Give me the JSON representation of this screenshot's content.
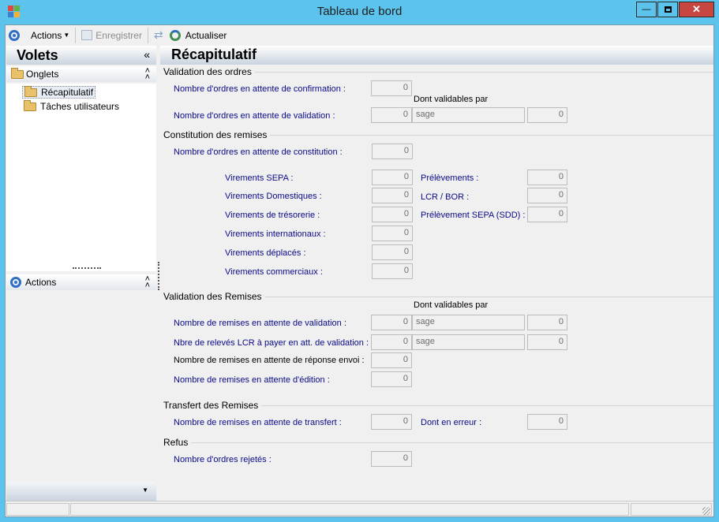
{
  "window": {
    "title": "Tableau de bord",
    "minimize_icon": "minimize-icon",
    "maximize_icon": "maximize-icon",
    "close_icon": "close-icon"
  },
  "toolbar": {
    "actions_label": "Actions",
    "save_label": "Enregistrer",
    "refresh_label": "Actualiser"
  },
  "left": {
    "header": "Volets",
    "onglets_label": "Onglets",
    "items": [
      {
        "label": "Récapitulatif"
      },
      {
        "label": "Tâches utilisateurs"
      }
    ],
    "actions_label": "Actions"
  },
  "main": {
    "title": "Récapitulatif",
    "validation_ordres": {
      "header": "Validation des ordres",
      "confirmation_label": "Nombre d'ordres en attente de confirmation :",
      "confirmation_value": "0",
      "dont_validables_label": "Dont validables par",
      "validation_label": "Nombre d'ordres en attente de validation :",
      "validation_value": "0",
      "validation_user": "sage",
      "validation_user_count": "0"
    },
    "constitution": {
      "header": "Constitution des remises",
      "constitution_label": "Nombre d'ordres en attente de constitution :",
      "constitution_value": "0",
      "left_items": [
        {
          "label": "Virements SEPA :",
          "value": "0"
        },
        {
          "label": "Virements Domestiques :",
          "value": "0"
        },
        {
          "label": "Virements de trésorerie :",
          "value": "0"
        },
        {
          "label": "Virements internationaux :",
          "value": "0"
        },
        {
          "label": "Virements déplacés :",
          "value": "0"
        },
        {
          "label": "Virements commerciaux :",
          "value": "0"
        }
      ],
      "right_items": [
        {
          "label": "Prélèvements :",
          "value": "0"
        },
        {
          "label": "LCR / BOR :",
          "value": "0"
        },
        {
          "label": "Prélèvement SEPA (SDD) :",
          "value": "0"
        }
      ]
    },
    "validation_remises": {
      "header": "Validation des Remises",
      "dont_validables_label": "Dont validables par",
      "rows": [
        {
          "label": "Nombre de remises en attente de validation :",
          "value": "0",
          "user": "sage",
          "user_count": "0"
        },
        {
          "label": "Nbre de relevés LCR à payer en att. de validation :",
          "value": "0",
          "user": "sage",
          "user_count": "0"
        },
        {
          "label": "Nombre de remises en attente de réponse envoi :",
          "value": "0"
        },
        {
          "label": "Nombre de remises en attente d'édition :",
          "value": "0"
        }
      ]
    },
    "transfert": {
      "header": "Transfert des Remises",
      "label": "Nombre de remises en attente de transfert :",
      "value": "0",
      "erreur_label": "Dont en erreur :",
      "erreur_value": "0"
    },
    "refus": {
      "header": "Refus",
      "label": "Nombre d'ordres rejetés :",
      "value": "0"
    }
  }
}
